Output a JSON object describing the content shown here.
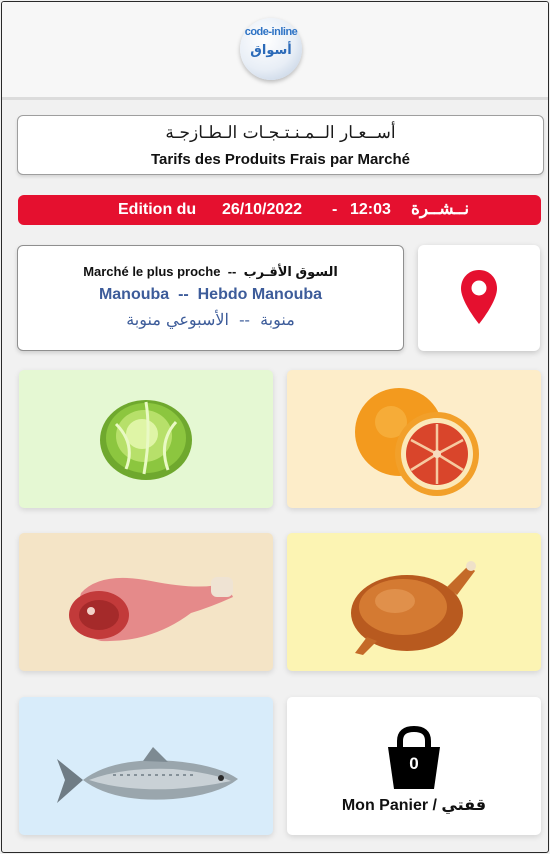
{
  "header": {
    "logo_top": "code-inline",
    "logo_main": "أسواق"
  },
  "title": {
    "arabic": "أســعـار الــمـنـتـجـات الـطـازجـة",
    "french": "Tarifs des Produits Frais par Marché"
  },
  "edition": {
    "label": "Edition du",
    "date": "26/10/2022",
    "separator": "-",
    "time": "12:03",
    "arabic_label": "نــشــرة",
    "color": "#e5102f"
  },
  "market": {
    "label_fr": "Marché le plus proche",
    "label_sep": "--",
    "label_ar": "السوق الأقـرب",
    "name_fr": "Manouba  --  Hebdo Manouba",
    "name_ar": "منوبة  --  الأسبوعي منوبة",
    "name_color": "#3d5c9a"
  },
  "location_icon": {
    "icon": "map-pin-icon",
    "color": "#e5102f"
  },
  "categories": [
    {
      "icon": "lettuce-icon",
      "background": "#e5f8d3"
    },
    {
      "icon": "orange-icon",
      "background": "#fdedc9"
    },
    {
      "icon": "meat-icon",
      "background": "#f4e4c6"
    },
    {
      "icon": "chicken-icon",
      "background": "#fcf4b3"
    },
    {
      "icon": "fish-icon",
      "background": "#d8ecfa"
    }
  ],
  "cart": {
    "icon": "basket-icon",
    "count": "0",
    "label": "Mon Panier / قفتي"
  }
}
